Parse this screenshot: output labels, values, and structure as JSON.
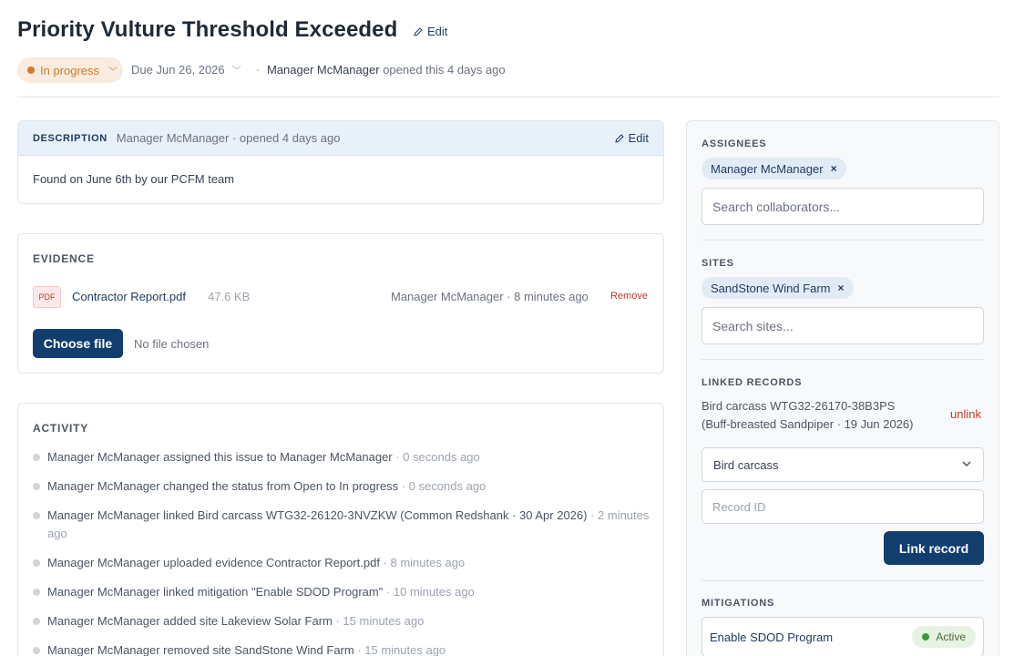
{
  "issue": {
    "title": "Priority Vulture Threshold Exceeded",
    "edit_label": "Edit",
    "status": "In progress",
    "due": "Due Jun 26, 2026",
    "separator": "·",
    "opened_by": "Manager McManager",
    "opened_text": "opened this 4 days ago"
  },
  "description": {
    "label": "DESCRIPTION",
    "meta": "Manager McManager · opened 4 days ago",
    "edit_label": "Edit",
    "body": "Found on June 6th by our PCFM team"
  },
  "evidence": {
    "label": "EVIDENCE",
    "file_type": "PDF",
    "file_name": "Contractor Report.pdf",
    "file_size": "47.6 KB",
    "file_meta": "Manager McManager · 8 minutes ago",
    "remove_label": "Remove",
    "choose_label": "Choose file",
    "no_file_label": "No file chosen"
  },
  "activity": {
    "label": "ACTIVITY",
    "items": [
      {
        "text": "Manager McManager assigned this issue to Manager McManager",
        "time": " · 0 seconds ago"
      },
      {
        "text": "Manager McManager changed the status from Open to In progress",
        "time": " · 0 seconds ago"
      },
      {
        "text": "Manager McManager linked Bird carcass WTG32-26120-3NVZKW (Common Redshank · 30 Apr 2026)",
        "time": " · 2 minutes ago"
      },
      {
        "text": "Manager McManager uploaded evidence Contractor Report.pdf",
        "time": " · 8 minutes ago"
      },
      {
        "text": "Manager McManager linked mitigation \"Enable SDOD Program\"",
        "time": " · 10 minutes ago"
      },
      {
        "text": "Manager McManager added site Lakeview Solar Farm",
        "time": " · 15 minutes ago"
      },
      {
        "text": "Manager McManager removed site SandStone Wind Farm",
        "time": " · 15 minutes ago"
      }
    ]
  },
  "sidebar": {
    "assignees": {
      "label": "ASSIGNEES",
      "chip": "Manager McManager",
      "remove_glyph": "×",
      "placeholder": "Search collaborators..."
    },
    "sites": {
      "label": "SITES",
      "chip": "SandStone Wind Farm",
      "remove_glyph": "×",
      "placeholder": "Search sites..."
    },
    "linked_records": {
      "label": "LINKED RECORDS",
      "record_line1": "Bird carcass WTG32-26170-38B3PS",
      "record_line2": "(Buff-breasted Sandpiper · 19 Jun 2026)",
      "unlink_label": "unlink",
      "type_selected": "Bird carcass",
      "record_id_placeholder": "Record ID",
      "link_button": "Link record"
    },
    "mitigations": {
      "label": "MITIGATIONS",
      "name": "Enable SDOD Program",
      "status": "Active"
    }
  },
  "colors": {
    "primary": "#123e6e",
    "status_in_progress": "#d2792b",
    "danger": "#c0392b",
    "active_green": "#3d9a3b"
  }
}
